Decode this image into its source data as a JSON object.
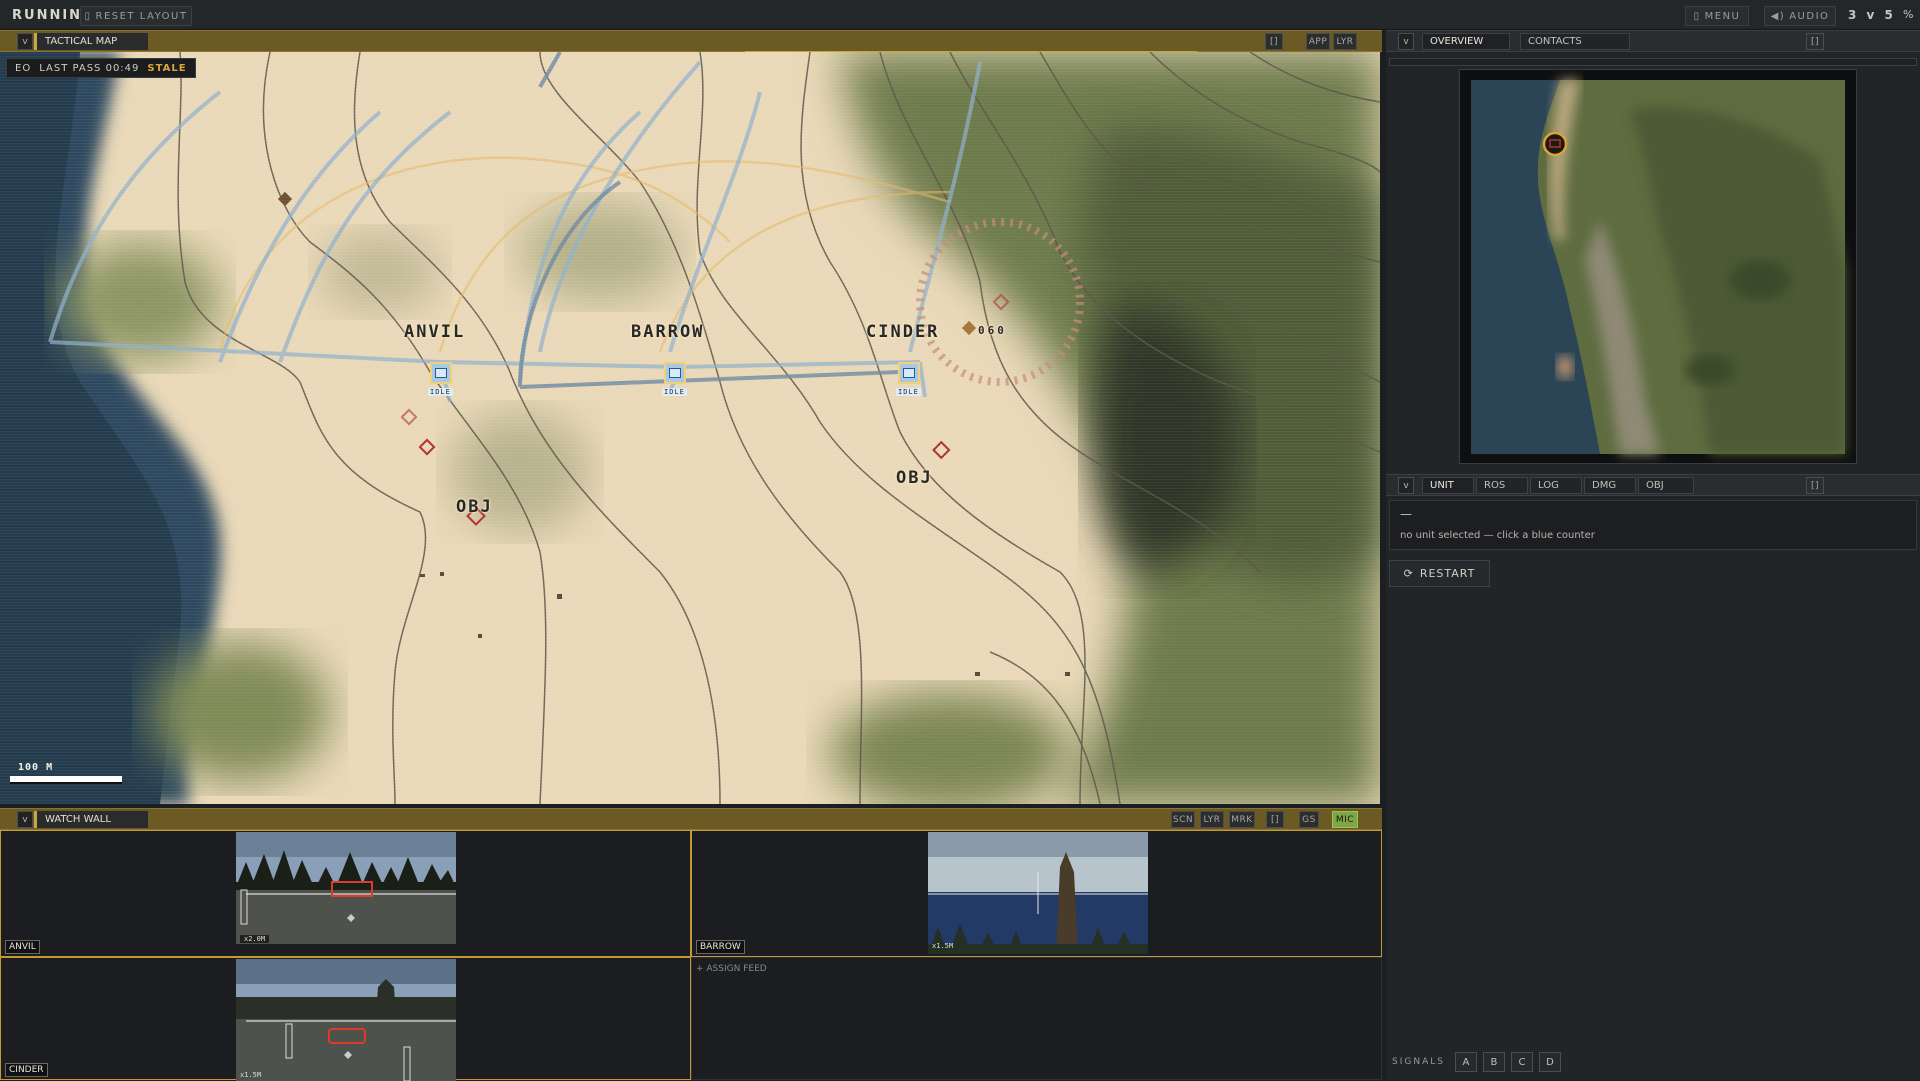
{
  "topbar": {
    "status": "RUNNING",
    "reset_layout": "RESET LAYOUT",
    "menu": "MENU",
    "audio": "AUDIO",
    "score": "3 v 5",
    "score_suffix": "%"
  },
  "tactical": {
    "header": "TACTICAL MAP",
    "collapse": "v",
    "expand": "[]",
    "app": "APP",
    "lyr": "LYR",
    "eo_badge": {
      "sensor": "EO",
      "pass": "LAST PASS 00:49",
      "state": "STALE"
    },
    "units": [
      {
        "name": "ANVIL",
        "tag": "IDLE"
      },
      {
        "name": "BARROW",
        "tag": "IDLE"
      },
      {
        "name": "CINDER",
        "tag": "IDLE"
      }
    ],
    "objectives": [
      "OBJ",
      "OBJ"
    ],
    "contact_label": "060",
    "scale": "100 M"
  },
  "watchwall": {
    "header": "WATCH WALL",
    "collapse": "v",
    "buttons": [
      "SCN",
      "LYR",
      "MRK",
      "[]",
      "GS"
    ],
    "mic": "MIC",
    "feeds": [
      {
        "name": "ANVIL",
        "zoom": "x2.0M"
      },
      {
        "name": "BARROW",
        "zoom": "x1.5M"
      },
      {
        "name": "CINDER",
        "zoom": "x1.5M"
      }
    ],
    "assign": "+ ASSIGN FEED"
  },
  "overview": {
    "collapse": "v",
    "tabs": [
      "OVERVIEW",
      "CONTACTS"
    ],
    "expand": "[]"
  },
  "unitpanel": {
    "collapse": "v",
    "tabs": [
      "UNIT",
      "ROS",
      "LOG",
      "DMG",
      "OBJ"
    ],
    "expand": "[]",
    "dash": "—",
    "message": "no unit selected — click a blue counter",
    "restart": "RESTART"
  },
  "signals": {
    "label": "SIGNALS",
    "buttons": [
      "A",
      "B",
      "C",
      "D"
    ]
  },
  "colors": {
    "header_gold": "#6b5a24",
    "accent": "#c9a640",
    "stale": "#d9a43a",
    "friendly": "#a8c8e4",
    "hostile": "#b0302a",
    "mic": "#8ab04a"
  }
}
